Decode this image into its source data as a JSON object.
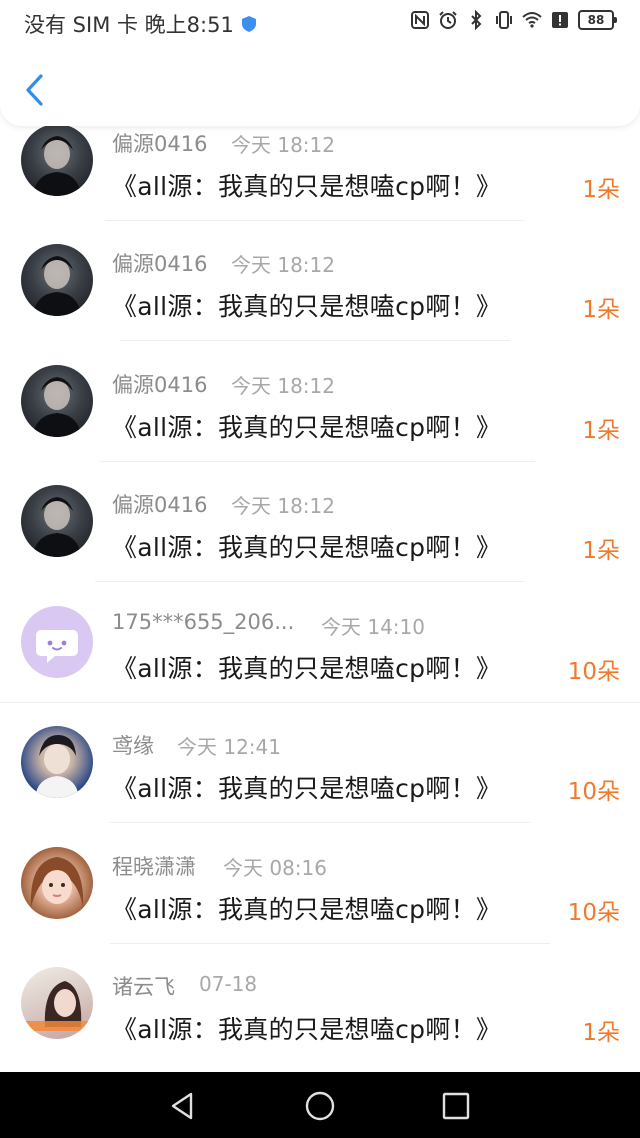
{
  "status_bar": {
    "left_text": "没有 SIM 卡 晚上8:51",
    "battery": "88",
    "icons": [
      "nfc-icon",
      "alarm-icon",
      "bluetooth-icon",
      "vibrate-icon",
      "wifi-icon",
      "alert-icon",
      "battery-icon"
    ]
  },
  "header": {
    "back_icon": "chevron-left-icon"
  },
  "colors": {
    "amount": "#ef7a2e",
    "name": "#8c8c8c",
    "title": "#1a1a1a",
    "accent": "#2f8fe8"
  },
  "rows": [
    {
      "name": "偏源0416",
      "time": "今天 18:12",
      "title": "《all源：我真的只是想嗑cp啊！》",
      "amount": "1朵",
      "avatar": "dark-portrait"
    },
    {
      "name": "偏源0416",
      "time": "今天 18:12",
      "title": "《all源：我真的只是想嗑cp啊！》",
      "amount": "1朵",
      "avatar": "dark-portrait"
    },
    {
      "name": "偏源0416",
      "time": "今天 18:12",
      "title": "《all源：我真的只是想嗑cp啊！》",
      "amount": "1朵",
      "avatar": "dark-portrait"
    },
    {
      "name": "偏源0416",
      "time": "今天 18:12",
      "title": "《all源：我真的只是想嗑cp啊！》",
      "amount": "1朵",
      "avatar": "dark-portrait"
    },
    {
      "name": "175***655_206...",
      "time": "今天 14:10",
      "title": "《all源：我真的只是想嗑cp啊！》",
      "amount": "10朵",
      "avatar": "chat-bubble-default"
    },
    {
      "name": "鸢缘",
      "time": "今天 12:41",
      "title": "《all源：我真的只是想嗑cp啊！》",
      "amount": "10朵",
      "avatar": "blue-portrait"
    },
    {
      "name": "程晓潇潇",
      "time": "今天 08:16",
      "title": "《all源：我真的只是想嗑cp啊！》",
      "amount": "10朵",
      "avatar": "girl-portrait"
    },
    {
      "name": "诸云飞",
      "time": "07-18",
      "title": "《all源：我真的只是想嗑cp啊！》",
      "amount": "1朵",
      "avatar": "pink-portrait"
    }
  ],
  "nav_bar": {
    "buttons": [
      "back-triangle",
      "home-circle",
      "recents-square"
    ]
  }
}
